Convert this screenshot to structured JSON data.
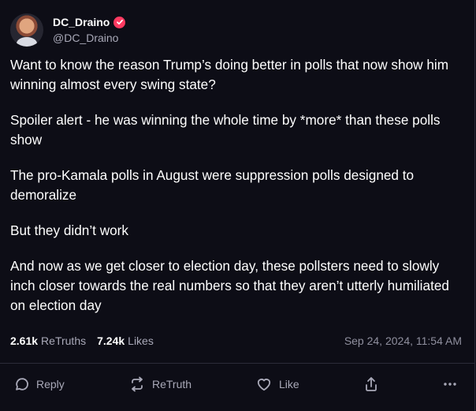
{
  "author": {
    "display_name": "DC_Draino",
    "handle": "@DC_Draino",
    "avatar_icon": "person-avatar",
    "verified_color": "#ff3a61"
  },
  "post": {
    "paragraphs": [
      "Want to know the reason Trump’s doing better in polls that now show him winning almost every swing state?",
      "Spoiler alert - he was winning the whole time by *more* than these polls show",
      "The pro-Kamala polls in August were suppression polls designed to demoralize",
      "But they didn’t work",
      "And now as we get closer to election day, these pollsters need to slowly inch closer towards the real numbers so that they aren’t utterly humiliated on election day"
    ],
    "retruths_count": "2.61k",
    "retruths_label": "ReTruths",
    "likes_count": "7.24k",
    "likes_label": "Likes",
    "timestamp": "Sep 24, 2024, 11:54 AM"
  },
  "actions": {
    "reply_label": "Reply",
    "retruth_label": "ReTruth",
    "like_label": "Like",
    "icons": {
      "reply": "reply-icon",
      "retruth": "retruth-icon",
      "like": "heart-icon",
      "share": "share-icon",
      "more": "more-icon"
    }
  },
  "colors": {
    "background": "#0d0d16",
    "text": "#ffffff",
    "muted": "#a9a9b8",
    "divider": "#2b2b39"
  }
}
